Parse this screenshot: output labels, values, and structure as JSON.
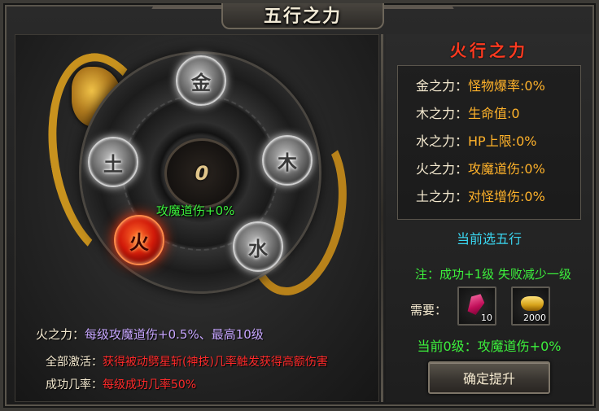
{
  "title": "五行之力",
  "left": {
    "center_value": "0",
    "elements": [
      {
        "glyph": "金",
        "active": false
      },
      {
        "glyph": "木",
        "active": false
      },
      {
        "glyph": "水",
        "active": false
      },
      {
        "glyph": "火",
        "active": true
      },
      {
        "glyph": "土",
        "active": false
      }
    ],
    "effect_label": "攻魔道伤+0%",
    "desc": [
      {
        "key": "火之力：",
        "value": "每级攻魔道伤+0.5%、最高10级"
      },
      {
        "key": "全部激活：",
        "value": "获得被动劈星斩(神技)几率触发获得高额伤害"
      },
      {
        "key": "成功几率：",
        "value": "每级成功几率50%"
      }
    ]
  },
  "right": {
    "title": "火行之力",
    "stats": [
      {
        "key": "金之力：",
        "value": "怪物爆率:0%"
      },
      {
        "key": "木之力：",
        "value": "生命值:0"
      },
      {
        "key": "水之力：",
        "value": "HP上限:0%"
      },
      {
        "key": "火之力：",
        "value": "攻魔道伤:0%"
      },
      {
        "key": "土之力：",
        "value": "对怪增伤:0%"
      }
    ],
    "current_select": "当前选五行",
    "note": "注：成功+1级 失败减少一级",
    "need_label": "需要：",
    "items": [
      {
        "icon": "gem-icon",
        "count": "10"
      },
      {
        "icon": "gold-ingot-icon",
        "count": "2000"
      }
    ],
    "current_level": "当前0级：攻魔道伤+0%",
    "confirm_button": "确定提升"
  },
  "colors": {
    "fire_title": "#ff3a20",
    "green_text": "#3cf03c",
    "cyan_text": "#3ad6f0",
    "stat_value": "#ffb22a",
    "red_text": "#ff2a2a",
    "purple_text": "#c7a6ff"
  }
}
